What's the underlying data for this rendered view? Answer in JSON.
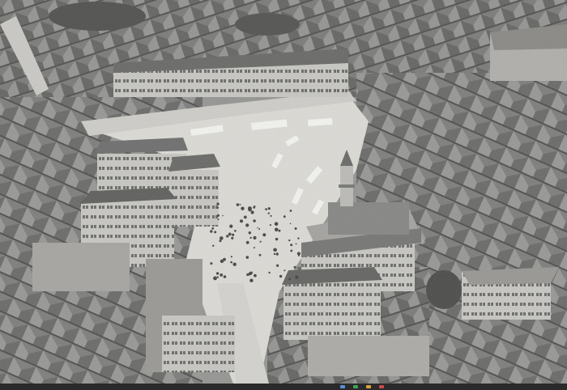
{
  "photo": {
    "subject": "",
    "palette": {
      "sky_haze": "#c9c9c7",
      "roof_dark": "#4a4a48",
      "roof_mid": "#777775",
      "wall_light": "#bdbcb8",
      "square_paving": "#d9d8d3",
      "street": "#c8c7c2",
      "tree": "#3c3c3a"
    }
  },
  "bottom_strip": {
    "accent_colors": [
      "#5b8fd6",
      "#3aa65a",
      "#d6a33a",
      "#c94a4a"
    ]
  }
}
